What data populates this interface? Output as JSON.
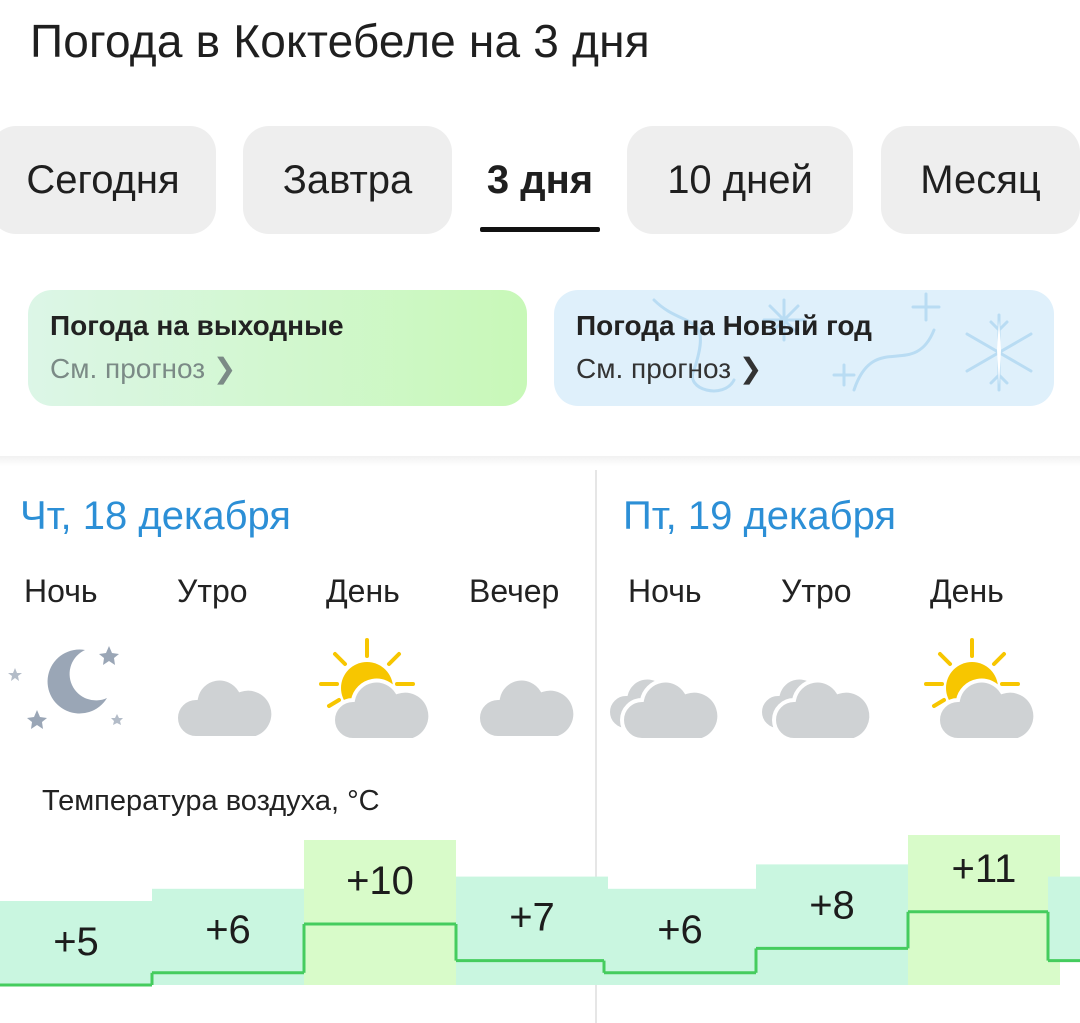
{
  "page": {
    "title": "Погода в Коктебеле на 3 дня"
  },
  "tabs": [
    {
      "label": "Сегодня",
      "active": false
    },
    {
      "label": "Завтра",
      "active": false
    },
    {
      "label": "3 дня",
      "active": true
    },
    {
      "label": "10 дней",
      "active": false
    },
    {
      "label": "Месяц",
      "active": false
    }
  ],
  "promos": {
    "weekend": {
      "title": "Погода на выходные",
      "link": "См. прогноз"
    },
    "new_year": {
      "title": "Погода на Новый год",
      "link": "См. прогноз"
    }
  },
  "days": [
    {
      "date": "Чт, 18 декабря",
      "periods": [
        {
          "name": "Ночь",
          "icon": "clear-night-icon"
        },
        {
          "name": "Утро",
          "icon": "cloudy-night-icon"
        },
        {
          "name": "День",
          "icon": "partly-cloudy-day-icon"
        },
        {
          "name": "Вечер",
          "icon": "cloudy-night-icon"
        }
      ]
    },
    {
      "date": "Пт, 19 декабря",
      "periods": [
        {
          "name": "Ночь",
          "icon": "cloudy-night-icon"
        },
        {
          "name": "Утро",
          "icon": "cloudy-night-icon"
        },
        {
          "name": "День",
          "icon": "partly-cloudy-day-icon"
        }
      ]
    }
  ],
  "temperature": {
    "caption": "Температура воздуха, °С",
    "values": [
      "+5",
      "+6",
      "+10",
      "+7",
      "+6",
      "+8",
      "+11"
    ],
    "numeric": [
      5,
      6,
      10,
      7,
      6,
      8,
      11
    ]
  },
  "colors": {
    "accent_date": "#2c8fd6",
    "temp_fill_cool": "#c9f6e0",
    "temp_fill_warm": "#d8fbc9",
    "temp_line": "#45cc5e",
    "sun": "#f7c600",
    "cloud": "#cfd2d4",
    "moon": "#9aa6b6"
  }
}
